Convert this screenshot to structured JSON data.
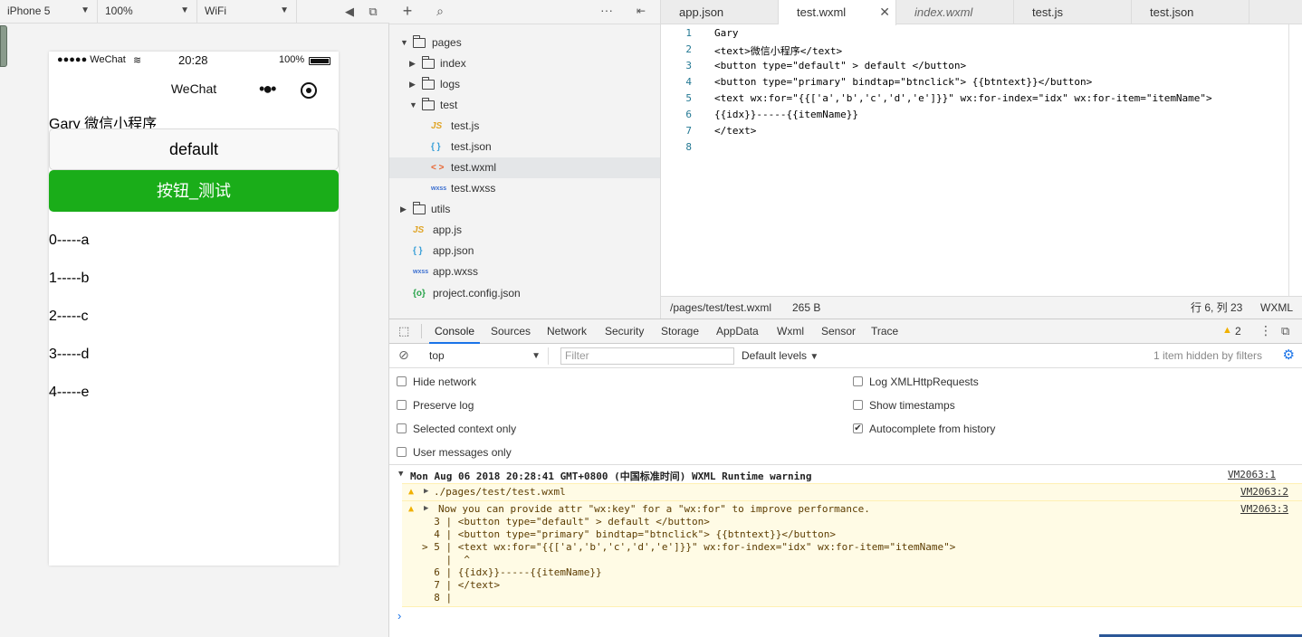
{
  "simulator": {
    "device": "iPhone 5",
    "zoom": "100%",
    "network": "WiFi",
    "status_bar": {
      "carrier": "●●●●● WeChat",
      "time": "20:28",
      "battery": "100%"
    },
    "nav_title": "WeChat",
    "page": {
      "text": "Gary 微信小程序",
      "default_button": "default",
      "primary_button": "按钮_测试",
      "items": [
        "0-----a",
        "1-----b",
        "2-----c",
        "3-----d",
        "4-----e"
      ]
    }
  },
  "file_tree": {
    "items": [
      {
        "label": "pages",
        "type": "folder",
        "expanded": true
      },
      {
        "label": "index",
        "type": "folder",
        "expanded": false
      },
      {
        "label": "logs",
        "type": "folder",
        "expanded": false
      },
      {
        "label": "test",
        "type": "folder",
        "expanded": true
      },
      {
        "label": "test.js",
        "type": "js",
        "icon": "JS"
      },
      {
        "label": "test.json",
        "type": "json",
        "icon": "{ }"
      },
      {
        "label": "test.wxml",
        "type": "wxml",
        "icon": "< >",
        "selected": true
      },
      {
        "label": "test.wxss",
        "type": "wxss",
        "icon": "wxss"
      },
      {
        "label": "utils",
        "type": "folder",
        "expanded": false
      },
      {
        "label": "app.js",
        "type": "js",
        "icon": "JS"
      },
      {
        "label": "app.json",
        "type": "json",
        "icon": "{ }"
      },
      {
        "label": "app.wxss",
        "type": "wxss",
        "icon": "wxss"
      },
      {
        "label": "project.config.json",
        "type": "config",
        "icon": "{o}"
      }
    ]
  },
  "editor": {
    "tabs": [
      "app.json",
      "test.wxml",
      "index.wxml",
      "test.js",
      "test.json"
    ],
    "active_tab": "test.wxml",
    "line_numbers": [
      "1",
      "2",
      "3",
      "4",
      "5",
      "6",
      "7",
      "8"
    ],
    "code_lines": [
      "Gary",
      "<text>微信小程序</text>",
      "<button type=\"default\" > default </button>",
      "<button type=\"primary\" bindtap=\"btnclick\"> {{btntext}}</button>",
      "<text wx:for=\"{{['a','b','c','d','e']}}\" wx:for-index=\"idx\" wx:for-item=\"itemName\">",
      "{{idx}}-----{{itemName}}",
      "</text>",
      ""
    ],
    "status": {
      "path": "/pages/test/test.wxml",
      "size": "265 B",
      "cursor": "行 6, 列 23",
      "language": "WXML"
    }
  },
  "devtools": {
    "tabs": [
      "Console",
      "Sources",
      "Network",
      "Security",
      "Storage",
      "AppData",
      "Wxml",
      "Sensor",
      "Trace"
    ],
    "active_tab": "Console",
    "warning_count": "2",
    "context": "top",
    "filter_placeholder": "Filter",
    "levels": "Default levels",
    "hidden_note": "1 item hidden by filters",
    "options_left": [
      "Hide network",
      "Preserve log",
      "Selected context only",
      "User messages only"
    ],
    "options_right": [
      "Log XMLHttpRequests",
      "Show timestamps",
      "Autocomplete from history"
    ],
    "log": {
      "header": "Mon Aug 06 2018 20:28:41 GMT+0800 (中国标准时间) WXML Runtime warning",
      "header_src": "VM2063:1",
      "warn1": "./pages/test/test.wxml",
      "warn1_src": "VM2063:2",
      "warn2": "Now you can provide attr \"wx:key\" for a \"wx:for\" to improve performance.",
      "warn2_src": "VM2063:3",
      "snippet": [
        "  3 | <button type=\"default\" > default </button>",
        "  4 | <button type=\"primary\" bindtap=\"btnclick\"> {{btntext}}</button>",
        "> 5 | <text wx:for=\"{{['a','b','c','d','e']}}\" wx:for-index=\"idx\" wx:for-item=\"itemName\">",
        "    |  ^",
        "  6 | {{idx}}-----{{itemName}}",
        "  7 | </text>",
        "  8 |"
      ]
    }
  }
}
